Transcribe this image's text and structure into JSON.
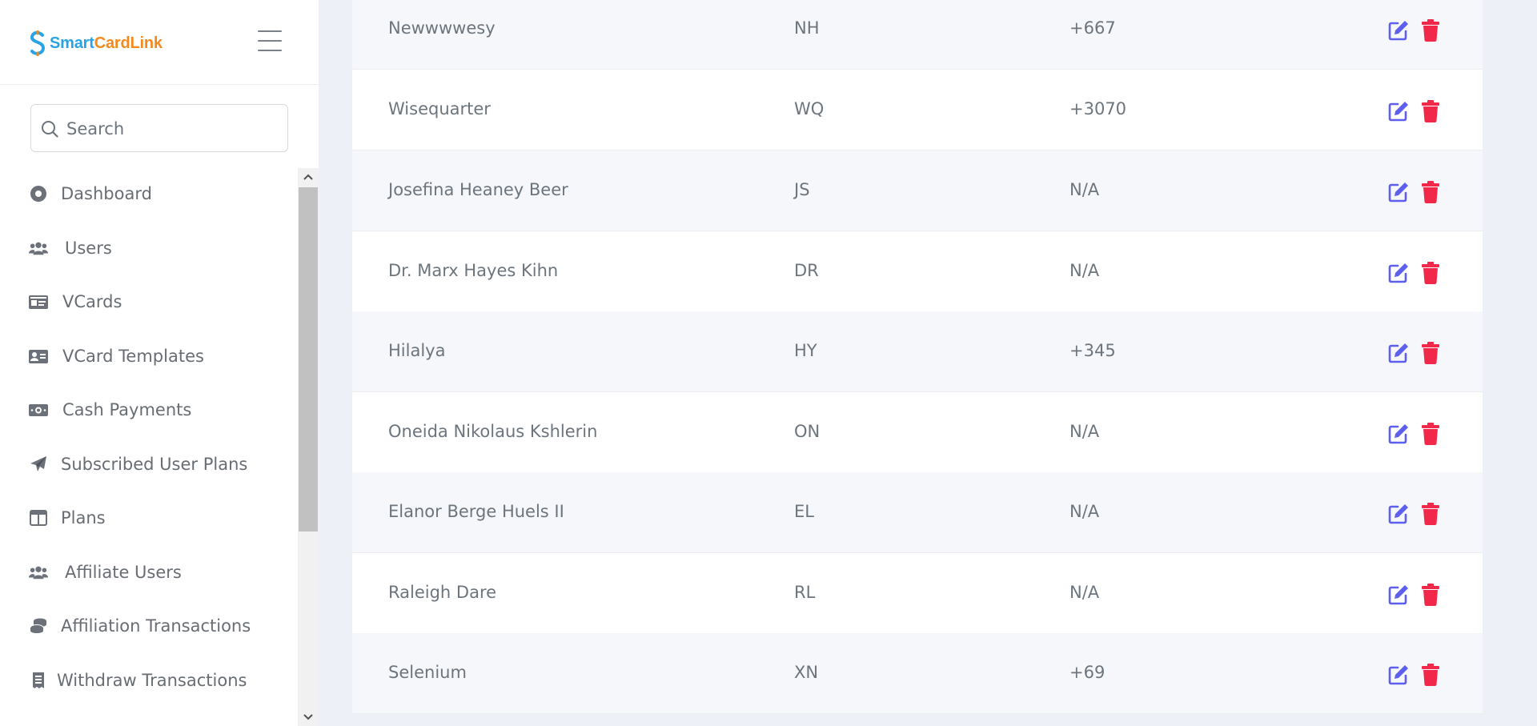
{
  "brand": {
    "logo_part1": "Smart",
    "logo_part2": "CardLink",
    "colors": {
      "primary": "#2aa3e6",
      "secondary": "#f28a1e"
    }
  },
  "search": {
    "placeholder": "Search"
  },
  "sidebar": {
    "items": [
      {
        "label": "Dashboard",
        "icon": "dashboard-icon"
      },
      {
        "label": "Users",
        "icon": "users-icon"
      },
      {
        "label": "VCards",
        "icon": "vcards-icon"
      },
      {
        "label": "VCard Templates",
        "icon": "vcard-templates-icon"
      },
      {
        "label": "Cash Payments",
        "icon": "cash-icon"
      },
      {
        "label": "Subscribed User Plans",
        "icon": "paper-plane-icon"
      },
      {
        "label": "Plans",
        "icon": "plans-icon"
      },
      {
        "label": "Affiliate Users",
        "icon": "users-icon"
      },
      {
        "label": "Affiliation Transactions",
        "icon": "coins-icon"
      },
      {
        "label": "Withdraw Transactions",
        "icon": "receipt-icon"
      }
    ]
  },
  "table": {
    "rows": [
      {
        "name": "Newwwwesy",
        "code": "NH",
        "phone": "+667"
      },
      {
        "name": "Wisequarter",
        "code": "WQ",
        "phone": "+3070"
      },
      {
        "name": "Josefina Heaney Beer",
        "code": "JS",
        "phone": "N/A"
      },
      {
        "name": "Dr. Marx Hayes Kihn",
        "code": "DR",
        "phone": "N/A"
      },
      {
        "name": "Hilalya",
        "code": "HY",
        "phone": "+345"
      },
      {
        "name": "Oneida Nikolaus Kshlerin",
        "code": "ON",
        "phone": "N/A"
      },
      {
        "name": "Elanor Berge Huels II",
        "code": "EL",
        "phone": "N/A"
      },
      {
        "name": "Raleigh Dare",
        "code": "RL",
        "phone": "N/A"
      },
      {
        "name": "Selenium",
        "code": "XN",
        "phone": "+69"
      }
    ],
    "colors": {
      "edit": "#5d5fef",
      "delete": "#f1284a"
    }
  }
}
